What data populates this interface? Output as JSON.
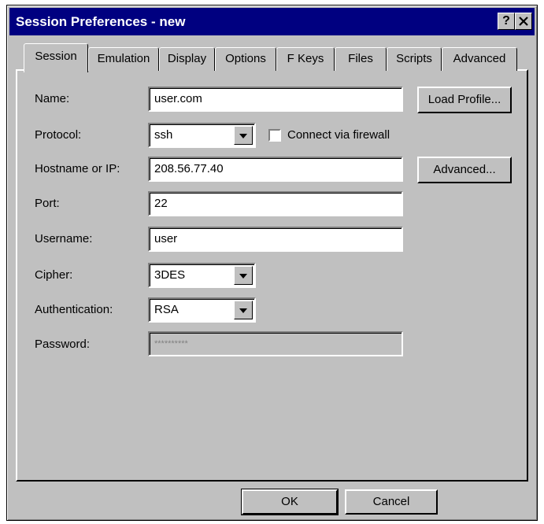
{
  "window": {
    "title": "Session Preferences - new",
    "help_button": "?",
    "close_button": "×"
  },
  "tabs": [
    {
      "label": "Session",
      "active": true
    },
    {
      "label": "Emulation"
    },
    {
      "label": "Display"
    },
    {
      "label": "Options"
    },
    {
      "label": "F Keys"
    },
    {
      "label": "Files"
    },
    {
      "label": "Scripts"
    },
    {
      "label": "Advanced"
    }
  ],
  "form": {
    "name": {
      "label": "Name:",
      "value": "user.com"
    },
    "protocol": {
      "label": "Protocol:",
      "value": "ssh"
    },
    "firewall": {
      "label": "Connect via firewall",
      "checked": false
    },
    "hostname": {
      "label": "Hostname or IP:",
      "value": "208.56.77.40"
    },
    "port": {
      "label": "Port:",
      "value": "22"
    },
    "username": {
      "label": "Username:",
      "value": "user"
    },
    "cipher": {
      "label": "Cipher:",
      "value": "3DES"
    },
    "authentication": {
      "label": "Authentication:",
      "value": "RSA"
    },
    "password": {
      "label": "Password:",
      "value": "**********"
    }
  },
  "buttons": {
    "load_profile": "Load Profile...",
    "advanced": "Advanced...",
    "ok": "OK",
    "cancel": "Cancel"
  },
  "colors": {
    "titlebar": "#000080",
    "face": "#c0c0c0"
  }
}
